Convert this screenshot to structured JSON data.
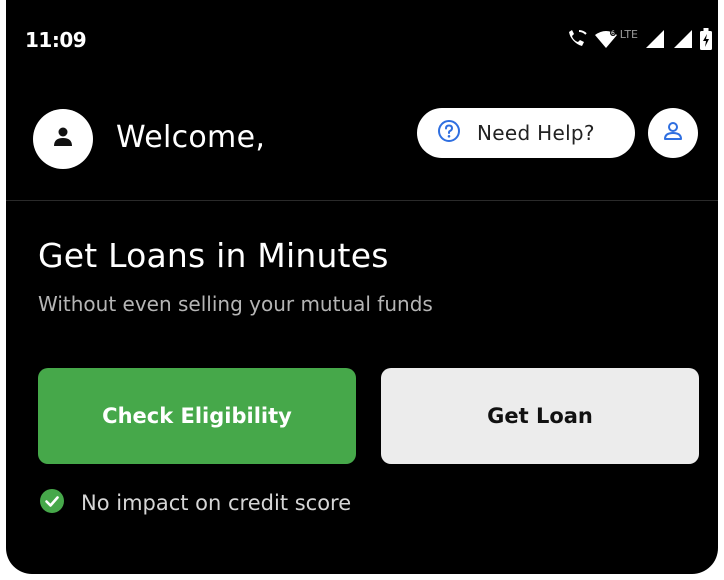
{
  "status_bar": {
    "time": "11:09",
    "network_label": "LTE",
    "icons": [
      "wifi-call-icon",
      "wifi-icon",
      "signal-icon",
      "signal-icon",
      "battery-icon"
    ]
  },
  "header": {
    "welcome_text": "Welcome,",
    "help_label": "Need Help?"
  },
  "hero": {
    "title": "Get Loans in Minutes",
    "subtitle": "Without even selling your mutual funds"
  },
  "actions": {
    "check_eligibility_label": "Check Eligibility",
    "get_loan_label": "Get Loan"
  },
  "note": {
    "text": "No impact on credit score"
  },
  "colors": {
    "background": "#000000",
    "primary_green": "#46a84a",
    "secondary_button": "#ececec",
    "accent_blue": "#2f6fe0"
  }
}
